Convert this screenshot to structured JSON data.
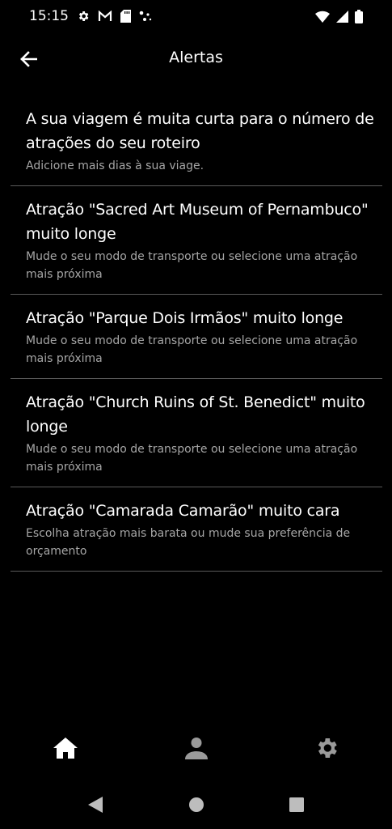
{
  "status_bar": {
    "time": "15:15",
    "icons": [
      "settings-icon",
      "gmail-icon",
      "sd-card-icon",
      "dots-icon",
      "wifi-icon",
      "signal-icon",
      "battery-icon"
    ]
  },
  "app_bar": {
    "title": "Alertas",
    "back_icon": "arrow-left-icon"
  },
  "alerts": [
    {
      "title": "A sua viagem é muita curta para o número de atrações do seu roteiro",
      "description": "Adicione mais dias à sua viage."
    },
    {
      "title": "Atração \"Sacred Art Museum of Pernambuco\" muito longe",
      "description": "Mude o seu modo de transporte ou selecione uma atração mais próxima"
    },
    {
      "title": "Atração \"Parque Dois Irmãos\" muito longe",
      "description": "Mude o seu modo de transporte ou selecione uma atração mais próxima"
    },
    {
      "title": "Atração \"Church Ruins of St. Benedict\" muito longe",
      "description": "Mude o seu modo de transporte ou selecione uma atração mais próxima"
    },
    {
      "title": "Atração \"Camarada Camarão\" muito cara",
      "description": "Escolha atração mais barata ou mude sua preferência de orçamento"
    }
  ],
  "bottom_nav": {
    "items": [
      "home-icon",
      "person-icon",
      "gear-icon"
    ]
  },
  "system_nav": {
    "items": [
      "back-triangle-icon",
      "home-circle-icon",
      "recents-square-icon"
    ]
  },
  "colors": {
    "background": "#000000",
    "text_primary": "#ffffff",
    "text_secondary": "#a6a6a6",
    "divider": "#5a5a5a"
  }
}
